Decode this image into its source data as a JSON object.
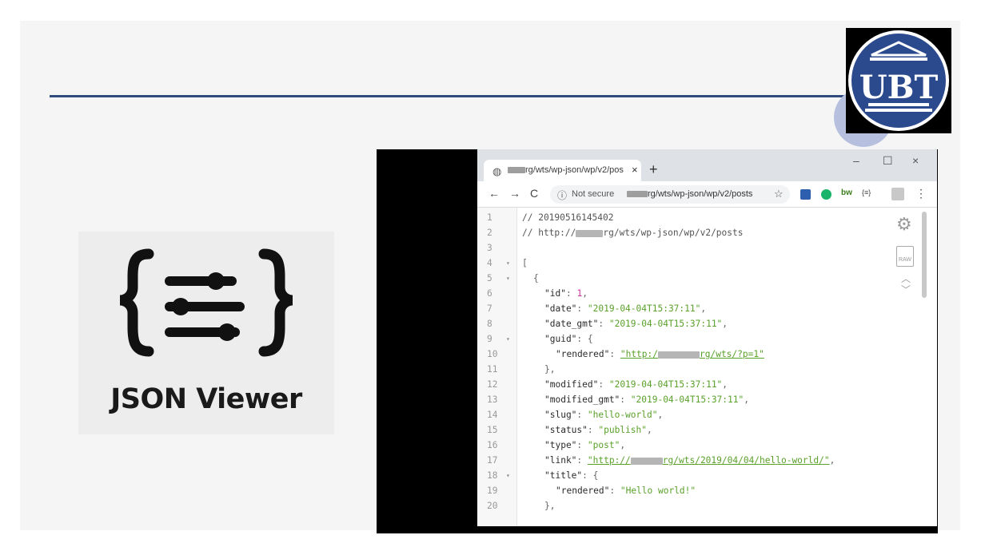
{
  "slide": {
    "logo_text": "UBT",
    "jv_title": "JSON Viewer"
  },
  "browser": {
    "tab": {
      "title_suffix": "rg/wts/wp-json/wp/v2/pos",
      "close": "×",
      "new_tab": "+"
    },
    "window": {
      "minimize": "–",
      "maximize": "☐",
      "close": "×"
    },
    "toolbar": {
      "back": "←",
      "forward": "→",
      "reload": "C",
      "not_secure": "Not secure",
      "url_suffix": "rg/wts/wp-json/wp/v2/posts",
      "star": "☆",
      "menu": "⋮"
    },
    "code_lines": [
      {
        "n": "1"
      },
      {
        "n": "2"
      },
      {
        "n": "3"
      },
      {
        "n": "4"
      },
      {
        "n": "5"
      },
      {
        "n": "6"
      },
      {
        "n": "7"
      },
      {
        "n": "8"
      },
      {
        "n": "9"
      },
      {
        "n": "10"
      },
      {
        "n": "11"
      },
      {
        "n": "12"
      },
      {
        "n": "13"
      },
      {
        "n": "14"
      },
      {
        "n": "15"
      },
      {
        "n": "16"
      },
      {
        "n": "17"
      },
      {
        "n": "18"
      },
      {
        "n": "19"
      },
      {
        "n": "20"
      }
    ],
    "code": {
      "l1": "// 20190516145402",
      "l2a": "// http://",
      "l2b": "rg/wts/wp-json/wp/v2/posts",
      "l4": "[",
      "l5": "{",
      "id_key": "\"id\"",
      "id_val": "1",
      "date_key": "\"date\"",
      "date_val": "\"2019-04-04T15:37:11\"",
      "dategmt_key": "\"date_gmt\"",
      "dategmt_val": "\"2019-04-04T15:37:11\"",
      "guid_key": "\"guid\"",
      "rendered_key": "\"rendered\"",
      "guid_url_a": "\"http:/",
      "guid_url_b": "rg/wts/?p=1\"",
      "close_brace": "},",
      "modified_key": "\"modified\"",
      "modified_val": "\"2019-04-04T15:37:11\"",
      "modgmt_key": "\"modified_gmt\"",
      "modgmt_val": "\"2019-04-04T15:37:11\"",
      "slug_key": "\"slug\"",
      "slug_val": "\"hello-world\"",
      "status_key": "\"status\"",
      "status_val": "\"publish\"",
      "type_key": "\"type\"",
      "type_val": "\"post\"",
      "link_key": "\"link\"",
      "link_url_a": "\"http://",
      "link_url_b": "rg/wts/2019/04/04/hello-world/\"",
      "title_key": "\"title\"",
      "title_val": "\"Hello world!\"",
      "raw_label": "RAW"
    }
  }
}
